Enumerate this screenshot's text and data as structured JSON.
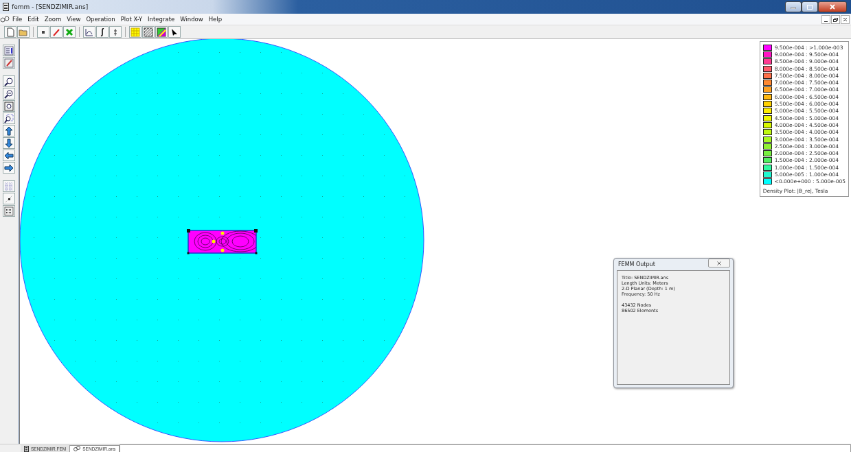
{
  "window": {
    "title": "femm - [SENDZIMIR.ans]"
  },
  "menu": [
    "File",
    "Edit",
    "Zoom",
    "View",
    "Operation",
    "Plot X-Y",
    "Integrate",
    "Window",
    "Help"
  ],
  "legend": {
    "entries": [
      {
        "range": "9.500e-004 : >1.000e-003",
        "color": "#ff00ff"
      },
      {
        "range": "9.000e-004 : 9.500e-004",
        "color": "#ff14c4"
      },
      {
        "range": "8.500e-004 : 9.000e-004",
        "color": "#ff3a92"
      },
      {
        "range": "8.000e-004 : 8.500e-004",
        "color": "#ff5a6a"
      },
      {
        "range": "7.500e-004 : 8.000e-004",
        "color": "#ff7048"
      },
      {
        "range": "7.000e-004 : 7.500e-004",
        "color": "#ff8830"
      },
      {
        "range": "6.500e-004 : 7.000e-004",
        "color": "#ffa020"
      },
      {
        "range": "6.000e-004 : 6.500e-004",
        "color": "#ffb810"
      },
      {
        "range": "5.500e-004 : 6.000e-004",
        "color": "#ffd000"
      },
      {
        "range": "5.000e-004 : 5.500e-004",
        "color": "#ffee00"
      },
      {
        "range": "4.500e-004 : 5.000e-004",
        "color": "#f0f800"
      },
      {
        "range": "4.000e-004 : 4.500e-004",
        "color": "#d8f800"
      },
      {
        "range": "3.500e-004 : 4.000e-004",
        "color": "#c0f810"
      },
      {
        "range": "3.000e-004 : 3.500e-004",
        "color": "#a8f820"
      },
      {
        "range": "2.500e-004 : 3.000e-004",
        "color": "#90f030"
      },
      {
        "range": "2.000e-004 : 2.500e-004",
        "color": "#78f040"
      },
      {
        "range": "1.500e-004 : 2.000e-004",
        "color": "#50f060"
      },
      {
        "range": "1.000e-004 : 1.500e-004",
        "color": "#30f8a0"
      },
      {
        "range": "5.000e-005 : 1.000e-004",
        "color": "#20f8d0"
      },
      {
        "range": "<0.000e+000 : 5.000e-005",
        "color": "#00ffff"
      }
    ],
    "caption": "Density Plot: |B_re|, Tesla"
  },
  "output_window": {
    "title": "FEMM Output",
    "paragraphs": [
      [
        "Title: SENDZIMIR.ans",
        "Length Units: Meters",
        "2-D Planar (Depth: 1 m)",
        "Frequency: 50 Hz"
      ],
      [
        "43432 Nodes",
        "86502 Elements"
      ]
    ]
  },
  "tabs": [
    {
      "label": "SENDZIMIR.FEM",
      "selected": false
    },
    {
      "label": "SENDZIMIR.ans",
      "selected": true
    }
  ]
}
